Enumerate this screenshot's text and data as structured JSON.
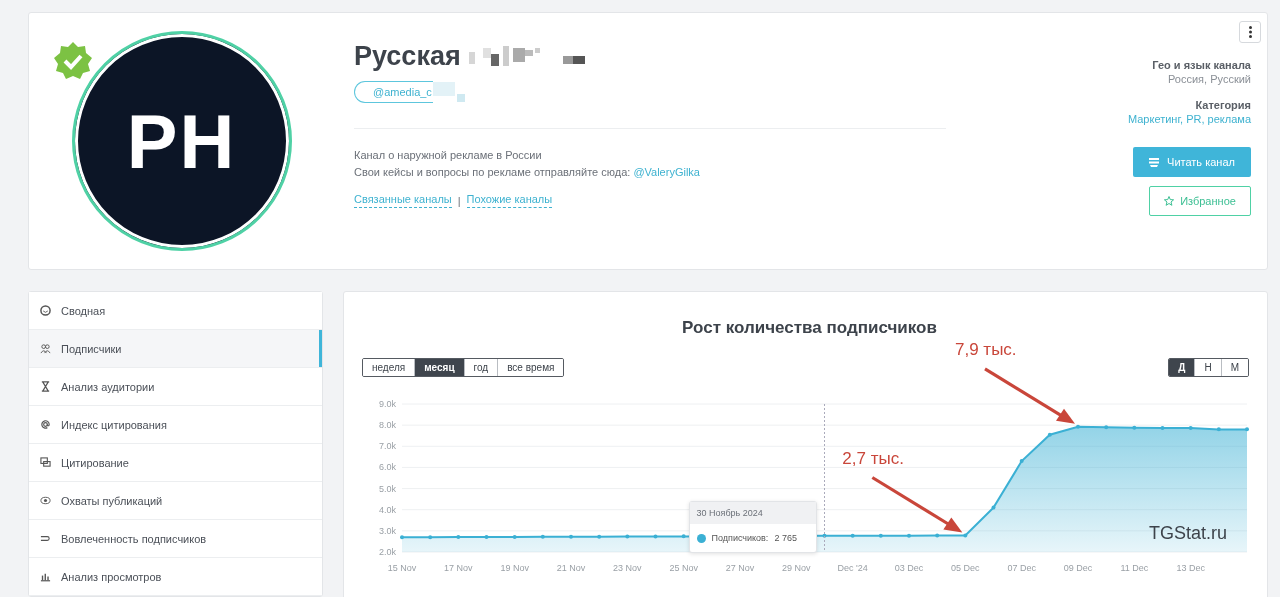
{
  "channel": {
    "title": "Русская",
    "handle": "@amedia_c",
    "verified": true,
    "avatar_text": "PH",
    "description": [
      "Канал о наружной рекламе в России",
      "Свои кейсы и вопросы по рекламе отправляйте сюда: "
    ],
    "description_link": "@ValeryGilka",
    "links": [
      "Связанные каналы",
      "Похожие каналы"
    ],
    "link_separator": "|",
    "geo_label": "Гео и язык канала",
    "geo_value": "Россия, Русский",
    "category_label": "Категория",
    "category_value": "Маркетинг, PR, реклама",
    "read_button": "Читать канал",
    "favorite_button": "Избранное"
  },
  "sidebar": {
    "items": [
      {
        "label": "Сводная",
        "selected": false
      },
      {
        "label": "Подписчики",
        "selected": true
      },
      {
        "label": "Анализ аудитории",
        "selected": false
      },
      {
        "label": "Индекс цитирования",
        "selected": false
      },
      {
        "label": "Цитирование",
        "selected": false
      },
      {
        "label": "Охваты публикаций",
        "selected": false
      },
      {
        "label": "Вовлеченность подписчиков",
        "selected": false
      },
      {
        "label": "Анализ просмотров",
        "selected": false
      }
    ]
  },
  "chart_panel": {
    "title": "Рост количества подписчиков",
    "periods": [
      {
        "label": "неделя",
        "selected": false
      },
      {
        "label": "месяц",
        "selected": true
      },
      {
        "label": "год",
        "selected": false
      },
      {
        "label": "все время",
        "selected": false
      }
    ],
    "granularity": [
      {
        "label": "Д",
        "selected": true
      },
      {
        "label": "Н",
        "selected": false
      },
      {
        "label": "М",
        "selected": false
      }
    ],
    "tooltip": {
      "title": "30 Ноябрь 2024",
      "value": "2 765"
    },
    "credit": "TGStat.ru",
    "chart_data": {
      "type": "area",
      "categories": [
        "15 Nov",
        null,
        "17 Nov",
        null,
        "19 Nov",
        null,
        "21 Nov",
        null,
        "23 Nov",
        null,
        "25 Nov",
        null,
        "27 Nov",
        null,
        "29 Nov",
        null,
        "Dec '24",
        null,
        "03 Dec",
        null,
        "05 Dec",
        null,
        "07 Dec",
        null,
        "09 Dec",
        null,
        "11 Dec",
        null,
        "13 Dec",
        null,
        null
      ],
      "series": [
        {
          "name": "Подписчиков:",
          "color": "#3bb0d4",
          "values": [
            2.7,
            2.7,
            2.71,
            2.71,
            2.71,
            2.72,
            2.72,
            2.72,
            2.73,
            2.73,
            2.74,
            null,
            null,
            null,
            null,
            2.77,
            2.77,
            2.77,
            2.77,
            2.78,
            2.78,
            4.1,
            6.3,
            7.55,
            7.92,
            7.9,
            7.88,
            7.87,
            7.86,
            7.8,
            7.8
          ]
        }
      ],
      "ylim": [
        2,
        9
      ],
      "grid": true,
      "yticks": [
        {
          "value": 2,
          "label": "2.0k"
        },
        {
          "value": 3,
          "label": "3.0k"
        },
        {
          "value": 4,
          "label": "4.0k"
        },
        {
          "value": 5,
          "label": "5.0k"
        },
        {
          "value": 6,
          "label": "6.0k"
        },
        {
          "value": 7,
          "label": "7.0k"
        },
        {
          "value": 8,
          "label": "8.0k"
        },
        {
          "value": 9,
          "label": "9.0k"
        }
      ],
      "annotations": [
        "2,7 тыс.",
        "7,9 тыс."
      ]
    }
  }
}
